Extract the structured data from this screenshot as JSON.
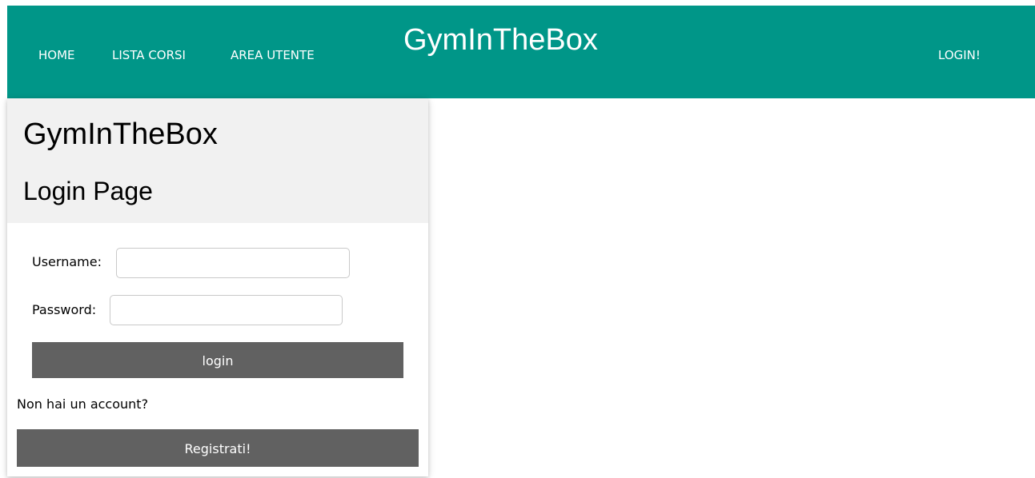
{
  "navbar": {
    "links": [
      "HOME",
      "LISTA CORSI",
      "AREA UTENTE"
    ],
    "brand": "GymInTheBox",
    "login_link": "LOGIN!",
    "background_color": "#009688"
  },
  "card": {
    "title": "GymInTheBox",
    "subtitle": "Login Page",
    "username_label": "Username:",
    "username_value": "",
    "password_label": "Password:",
    "password_value": "",
    "login_button": "login",
    "no_account_text": "Non hai un account?",
    "register_button": "Registrati!",
    "header_background": "#f1f1f1",
    "button_color": "#616161"
  }
}
